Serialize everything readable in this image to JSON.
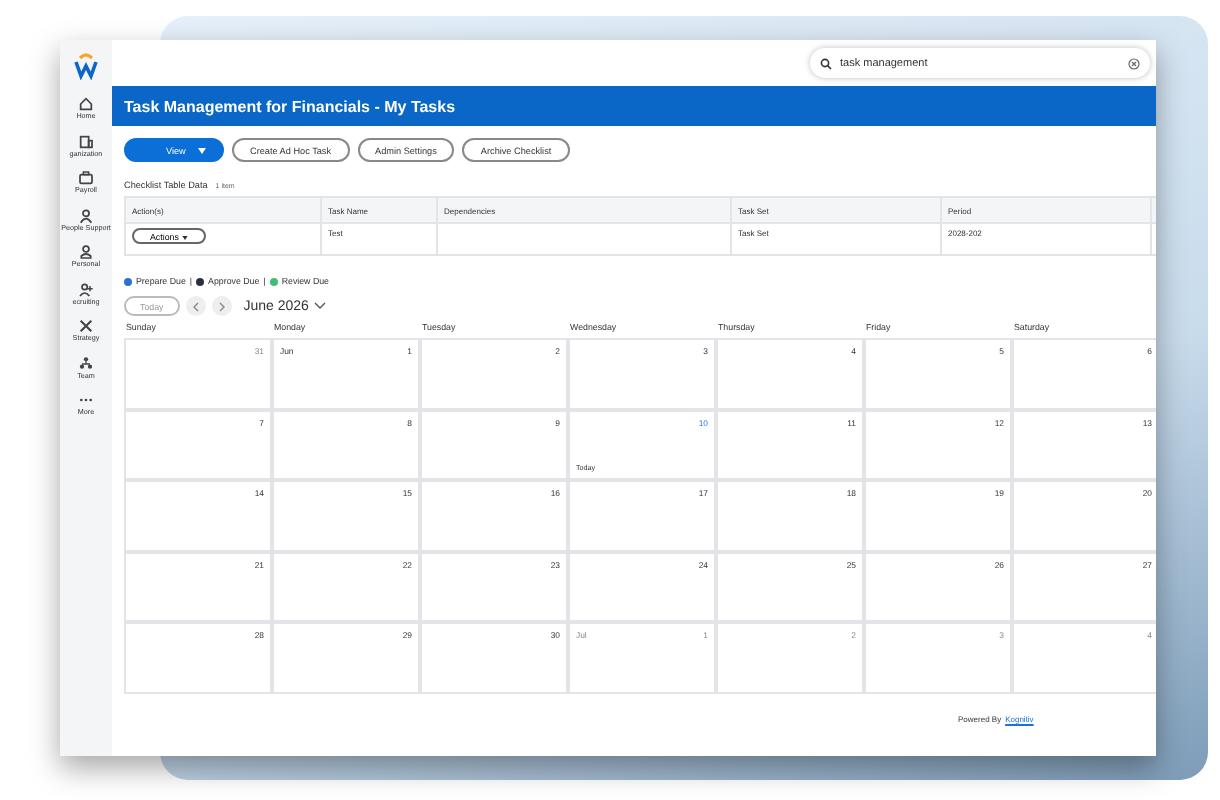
{
  "search": {
    "value": "task management"
  },
  "sidebar": {
    "items": [
      {
        "label": "Home",
        "kind": "home"
      },
      {
        "label": "ganization",
        "kind": "building"
      },
      {
        "label": "Payroll",
        "kind": "wallet"
      },
      {
        "label": "People Support",
        "kind": "support"
      },
      {
        "label": "Personal",
        "kind": "person"
      },
      {
        "label": "ecruiting",
        "kind": "recruit"
      },
      {
        "label": "Strategy",
        "kind": "tools"
      },
      {
        "label": "Team",
        "kind": "team"
      },
      {
        "label": "More",
        "kind": "more"
      }
    ]
  },
  "header": {
    "title": "Task Management for Financials - My Tasks"
  },
  "toolbar": {
    "primary": "View",
    "buttons": [
      "Create Ad Hoc Task",
      "Admin Settings",
      "Archive Checklist"
    ]
  },
  "table": {
    "title": "Checklist Table Data",
    "count": "1 item",
    "columns": [
      "Action(s)",
      "Task Name",
      "Dependencies",
      "Task Set",
      "Period"
    ],
    "rows": [
      {
        "action": "Actions",
        "task_name": "Test",
        "dependencies": "",
        "task_set": "Task Set",
        "period": "2028-202"
      }
    ]
  },
  "legend": [
    {
      "label": "Prepare Due",
      "color": "#2f6fd6",
      "separator": "|"
    },
    {
      "label": "Approve Due",
      "color": "#2b2f45",
      "separator": "|"
    },
    {
      "label": "Review Due",
      "color": "#3fbf6f"
    }
  ],
  "calendar": {
    "today_button": "Today",
    "month": "June 2026",
    "weekdays": [
      "Sunday",
      "Monday",
      "Tuesday",
      "Wednesday",
      "Thursday",
      "Friday",
      "Saturday"
    ],
    "today_label": "Today",
    "weeks": [
      [
        {
          "day": "31",
          "in_month": false,
          "today": false
        },
        {
          "month": "Jun",
          "day": "1",
          "in_month": true,
          "today": false
        },
        {
          "day": "2",
          "in_month": true,
          "today": false
        },
        {
          "day": "3",
          "in_month": true,
          "today": false
        },
        {
          "day": "4",
          "in_month": true,
          "today": false
        },
        {
          "day": "5",
          "in_month": true,
          "today": false
        },
        {
          "day": "6",
          "in_month": true,
          "today": false
        }
      ],
      [
        {
          "day": "7",
          "in_month": true,
          "today": false
        },
        {
          "day": "8",
          "in_month": true,
          "today": false
        },
        {
          "day": "9",
          "in_month": true,
          "today": false
        },
        {
          "day": "10",
          "in_month": true,
          "today": true
        },
        {
          "day": "11",
          "in_month": true,
          "today": false
        },
        {
          "day": "12",
          "in_month": true,
          "today": false
        },
        {
          "day": "13",
          "in_month": true,
          "today": false
        }
      ],
      [
        {
          "day": "14",
          "in_month": true,
          "today": false
        },
        {
          "day": "15",
          "in_month": true,
          "today": false
        },
        {
          "day": "16",
          "in_month": true,
          "today": false
        },
        {
          "day": "17",
          "in_month": true,
          "today": false
        },
        {
          "day": "18",
          "in_month": true,
          "today": false
        },
        {
          "day": "19",
          "in_month": true,
          "today": false
        },
        {
          "day": "20",
          "in_month": true,
          "today": false
        }
      ],
      [
        {
          "day": "21",
          "in_month": true,
          "today": false
        },
        {
          "day": "22",
          "in_month": true,
          "today": false
        },
        {
          "day": "23",
          "in_month": true,
          "today": false
        },
        {
          "day": "24",
          "in_month": true,
          "today": false
        },
        {
          "day": "25",
          "in_month": true,
          "today": false
        },
        {
          "day": "26",
          "in_month": true,
          "today": false
        },
        {
          "day": "27",
          "in_month": true,
          "today": false
        }
      ],
      [
        {
          "day": "28",
          "in_month": true,
          "today": false
        },
        {
          "day": "29",
          "in_month": true,
          "today": false
        },
        {
          "day": "30",
          "in_month": true,
          "today": false
        },
        {
          "month": "Jul",
          "day": "1",
          "in_month": false,
          "today": false
        },
        {
          "day": "2",
          "in_month": false,
          "today": false
        },
        {
          "day": "3",
          "in_month": false,
          "today": false
        },
        {
          "day": "4",
          "in_month": false,
          "today": false
        }
      ]
    ]
  },
  "footer": {
    "text": "Powered By",
    "link": "Kognitiv"
  }
}
